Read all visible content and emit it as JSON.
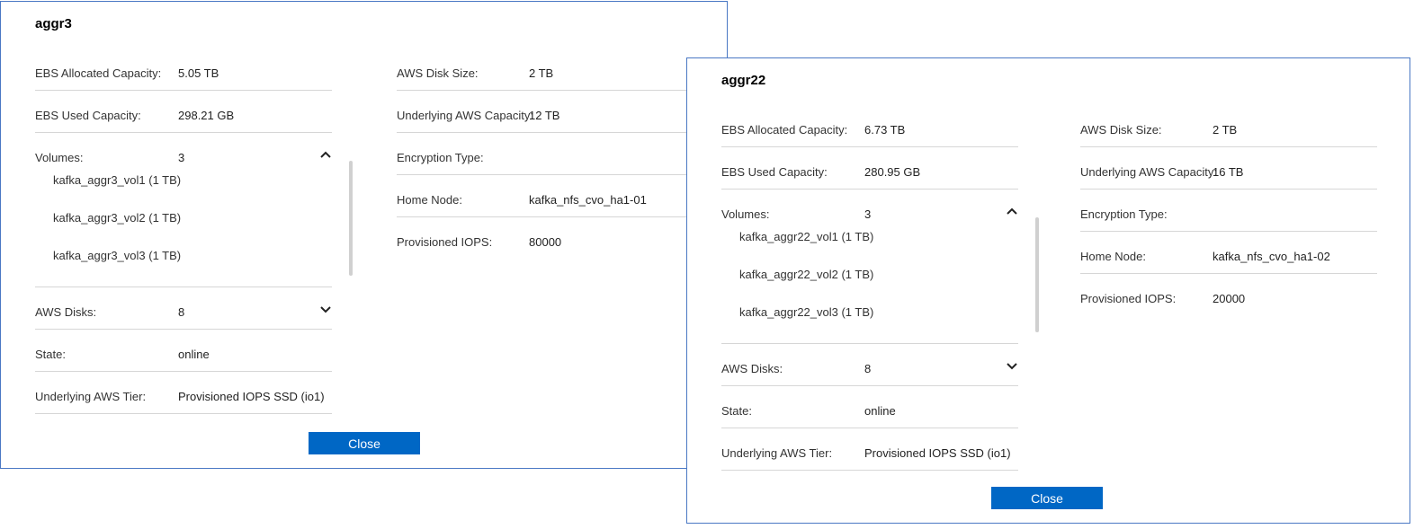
{
  "dialogs": [
    {
      "title": "aggr3",
      "left": {
        "ebs_allocated_label": "EBS Allocated Capacity:",
        "ebs_allocated_value": "5.05 TB",
        "ebs_used_label": "EBS Used Capacity:",
        "ebs_used_value": "298.21 GB",
        "volumes_label": "Volumes:",
        "volumes_value": "3",
        "volumes": [
          "kafka_aggr3_vol1 (1 TB)",
          "kafka_aggr3_vol2 (1 TB)",
          "kafka_aggr3_vol3 (1 TB)"
        ],
        "aws_disks_label": "AWS Disks:",
        "aws_disks_value": "8",
        "state_label": "State:",
        "state_value": "online",
        "tier_label": "Underlying AWS Tier:",
        "tier_value": "Provisioned IOPS SSD (io1)"
      },
      "right": {
        "disk_size_label": "AWS Disk Size:",
        "disk_size_value": "2 TB",
        "aws_capacity_label": "Underlying AWS Capacity:",
        "aws_capacity_value": "12 TB",
        "encryption_label": "Encryption Type:",
        "encryption_value": "",
        "home_node_label": "Home Node:",
        "home_node_value": "kafka_nfs_cvo_ha1-01",
        "iops_label": "Provisioned IOPS:",
        "iops_value": "80000"
      },
      "close_label": "Close"
    },
    {
      "title": "aggr22",
      "left": {
        "ebs_allocated_label": "EBS Allocated Capacity:",
        "ebs_allocated_value": "6.73 TB",
        "ebs_used_label": "EBS Used Capacity:",
        "ebs_used_value": "280.95 GB",
        "volumes_label": "Volumes:",
        "volumes_value": "3",
        "volumes": [
          "kafka_aggr22_vol1 (1 TB)",
          "kafka_aggr22_vol2 (1 TB)",
          "kafka_aggr22_vol3 (1 TB)"
        ],
        "aws_disks_label": "AWS Disks:",
        "aws_disks_value": "8",
        "state_label": "State:",
        "state_value": "online",
        "tier_label": "Underlying AWS Tier:",
        "tier_value": "Provisioned IOPS SSD (io1)"
      },
      "right": {
        "disk_size_label": "AWS Disk Size:",
        "disk_size_value": "2 TB",
        "aws_capacity_label": "Underlying AWS Capacity:",
        "aws_capacity_value": "16 TB",
        "encryption_label": "Encryption Type:",
        "encryption_value": "",
        "home_node_label": "Home Node:",
        "home_node_value": "kafka_nfs_cvo_ha1-02",
        "iops_label": "Provisioned IOPS:",
        "iops_value": "20000"
      },
      "close_label": "Close"
    }
  ],
  "icons": {
    "collapse": "chevron-up-icon",
    "expand": "chevron-down-icon"
  },
  "colors": {
    "dialog_border": "#4a78c4",
    "button_bg": "#0067c5",
    "divider": "#d6d6d6"
  }
}
